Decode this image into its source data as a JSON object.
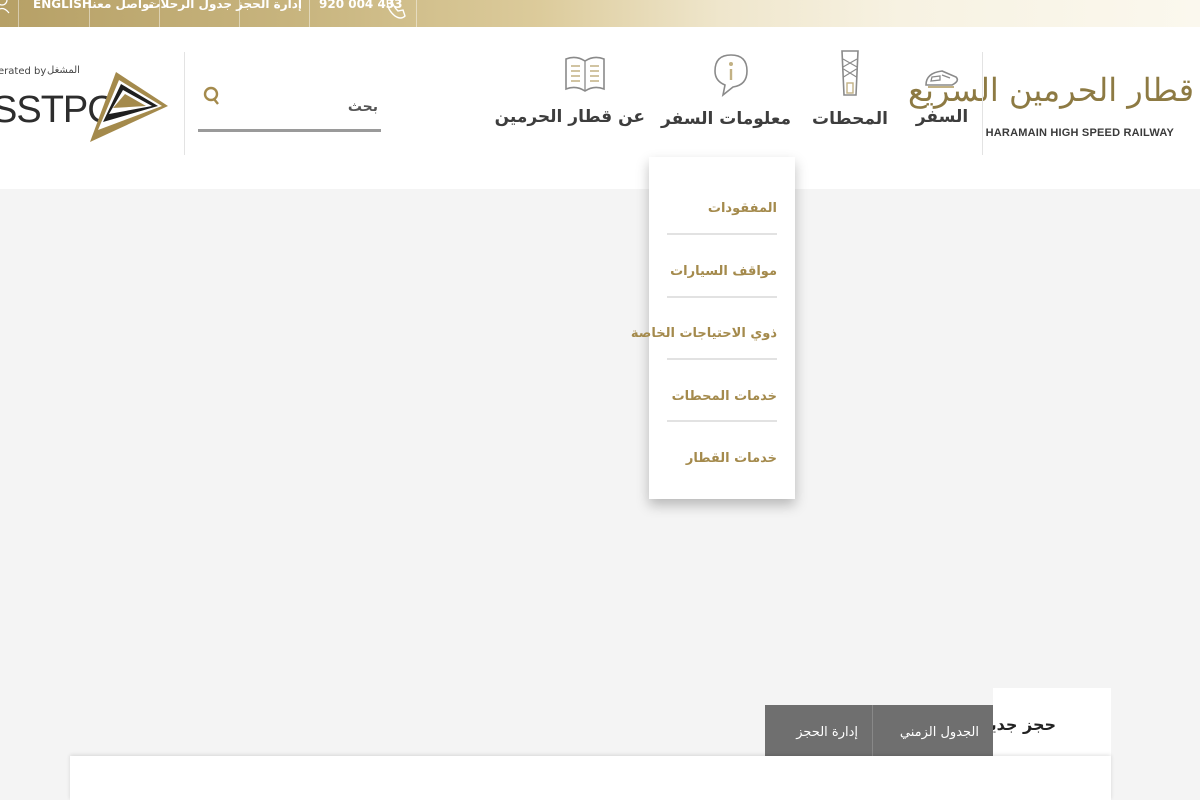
{
  "topbar": {
    "language_label": "ENGLISH",
    "contact_label": "تواصل معنا",
    "schedule_label": "جدول الرحلات",
    "manage_booking_label": "إدارة الحجز",
    "phone": "920 004 433"
  },
  "brand": {
    "name_ar": "قطار الحرمين السريع",
    "name_en": "HARAMAIN HIGH SPEED RAILWAY"
  },
  "nav": {
    "items": [
      {
        "label": "السفر",
        "icon": "train-icon"
      },
      {
        "label": "المحطات",
        "icon": "station-tower-icon"
      },
      {
        "label": "معلومات السفر",
        "icon": "info-bubble-icon"
      },
      {
        "label": "عن قطار الحرمين",
        "icon": "open-book-icon"
      }
    ]
  },
  "search": {
    "placeholder": "بحث"
  },
  "operator": {
    "label_en": "erated by",
    "label_ar": "المشغل",
    "name": "SSTPC"
  },
  "dropdown": {
    "items": [
      {
        "label": "المفقودات"
      },
      {
        "label": "مواقف السيارات"
      },
      {
        "label": "ذوي الاحتياجات الخاصة"
      },
      {
        "label": "خدمات المحطات"
      },
      {
        "label": "خدمات القطار"
      }
    ]
  },
  "booking": {
    "tabs": [
      {
        "label": "حجز جديد",
        "active": true
      },
      {
        "label": "الجدول الزمني",
        "active": false
      },
      {
        "label": "إدارة الحجز",
        "active": false
      }
    ]
  },
  "colors": {
    "gold": "#a48a4c",
    "brand_text": "#8d7a43",
    "tab_grey": "#6f6f6f",
    "page_bg": "#f4f4f4"
  }
}
